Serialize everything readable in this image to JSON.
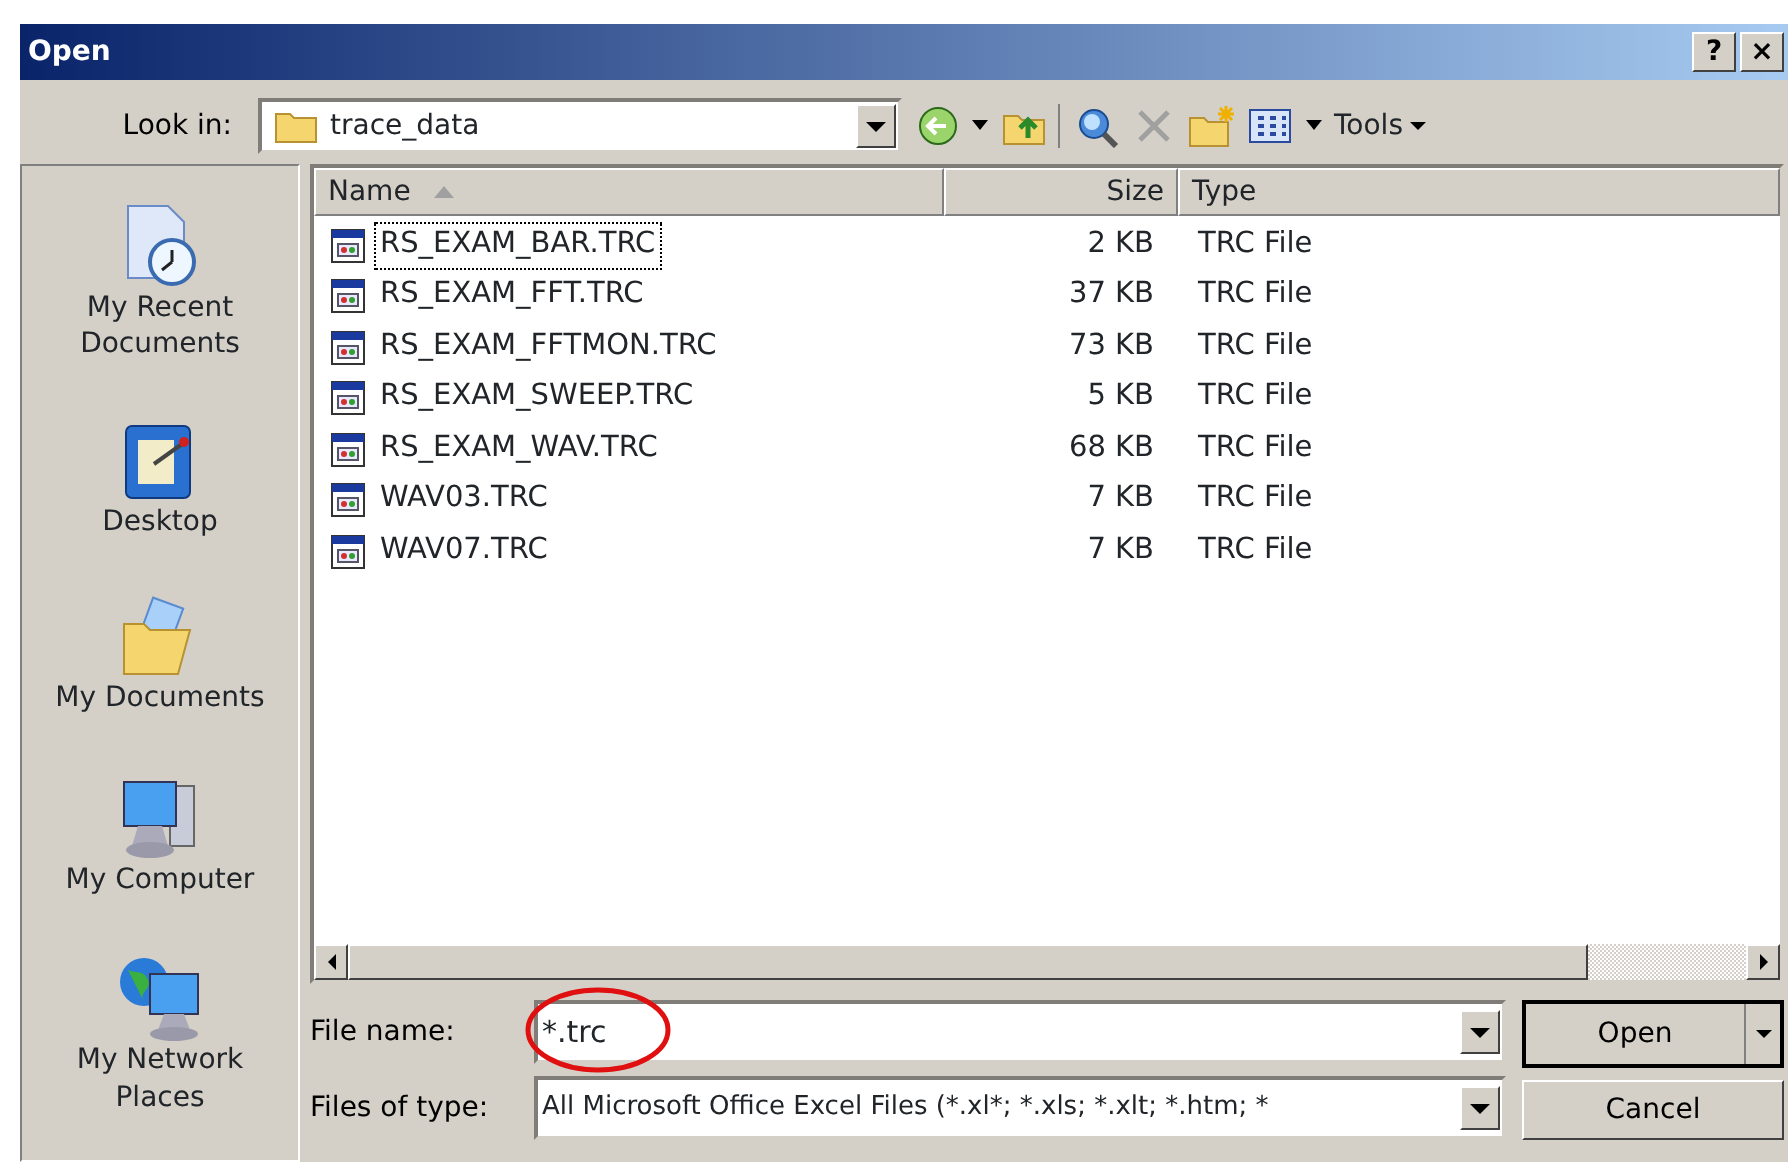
{
  "window": {
    "title": "Open",
    "buttons": [
      "?",
      "×"
    ]
  },
  "look_in": {
    "label": "Look in:",
    "value": "trace_data"
  },
  "toolbar": {
    "tools_label": "Tools"
  },
  "places": [
    {
      "label": "My Recent Documents",
      "kind": "recent"
    },
    {
      "label": "Desktop",
      "kind": "desktop"
    },
    {
      "label": "My Documents",
      "kind": "documents"
    },
    {
      "label": "My Computer",
      "kind": "computer"
    },
    {
      "label": "My Network Places",
      "kind": "network"
    }
  ],
  "file_list": {
    "columns": [
      {
        "label": "Name",
        "sorted": true
      },
      {
        "label": "Size",
        "sorted": false
      },
      {
        "label": "Type",
        "sorted": false
      }
    ],
    "rows": [
      {
        "name": "RS_EXAM_BAR.TRC",
        "size": "2 KB",
        "type": "TRC File",
        "focused": true
      },
      {
        "name": "RS_EXAM_FFT.TRC",
        "size": "37 KB",
        "type": "TRC File",
        "focused": false
      },
      {
        "name": "RS_EXAM_FFTMON.TRC",
        "size": "73 KB",
        "type": "TRC File",
        "focused": false
      },
      {
        "name": "RS_EXAM_SWEEP.TRC",
        "size": "5 KB",
        "type": "TRC File",
        "focused": false
      },
      {
        "name": "RS_EXAM_WAV.TRC",
        "size": "68 KB",
        "type": "TRC File",
        "focused": false
      },
      {
        "name": "WAV03.TRC",
        "size": "7 KB",
        "type": "TRC File",
        "focused": false
      },
      {
        "name": "WAV07.TRC",
        "size": "7 KB",
        "type": "TRC File",
        "focused": false
      }
    ]
  },
  "file_name": {
    "label": "File name:",
    "value": "*.trc",
    "circled": true
  },
  "files_of_type": {
    "label": "Files of type:",
    "value": "All Microsoft Office Excel Files (*.xl*; *.xls; *.xlt; *.htm; *"
  },
  "buttons": [
    {
      "label": "Open",
      "kind": "split"
    },
    {
      "label": "Cancel",
      "kind": "plain"
    }
  ]
}
